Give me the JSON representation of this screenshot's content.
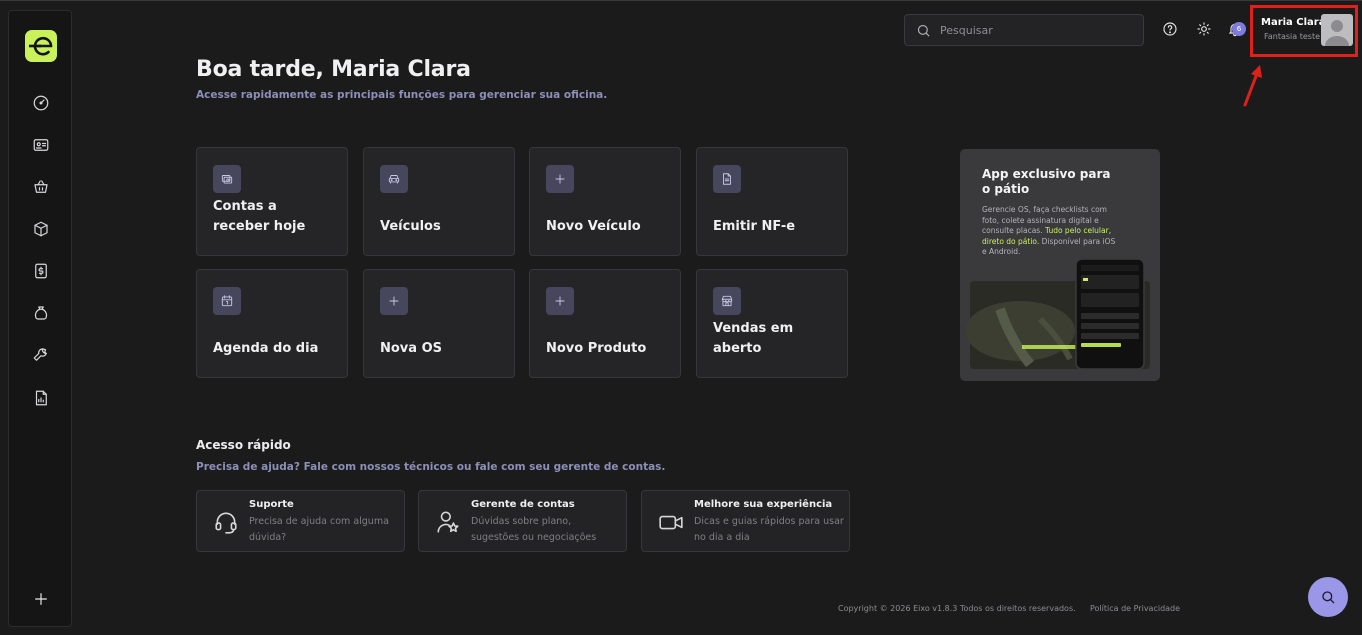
{
  "header": {
    "search_placeholder": "Pesquisar",
    "notification_count": "6",
    "user_name": "Maria Clara",
    "user_company": "Fantasia teste"
  },
  "greeting": {
    "title": "Boa tarde, Maria Clara",
    "subtitle": "Acesse rapidamente as principais funções para gerenciar sua oficina."
  },
  "cards": [
    {
      "label": "Contas a receber hoje",
      "icon": "money-receive-icon"
    },
    {
      "label": "Veículos",
      "icon": "car-icon"
    },
    {
      "label": "Novo Veículo",
      "icon": "plus-icon"
    },
    {
      "label": "Emitir NF-e",
      "icon": "document-icon"
    },
    {
      "label": "Agenda do dia",
      "icon": "calendar-icon"
    },
    {
      "label": "Nova OS",
      "icon": "plus-icon"
    },
    {
      "label": "Novo Produto",
      "icon": "plus-icon"
    },
    {
      "label": "Vendas em aberto",
      "icon": "store-icon"
    }
  ],
  "promo": {
    "title": "App exclusivo para o pátio",
    "text_before": "Gerencie OS, faça checklists com foto, colete assinatura digital e consulte placas. ",
    "text_highlight": "Tudo pelo celular, direto do pátio.",
    "text_after": " Disponível para iOS e Android."
  },
  "quick_access": {
    "title": "Acesso rápido",
    "subtitle": "Precisa de ajuda? Fale com nossos técnicos ou fale com seu gerente de contas.",
    "items": [
      {
        "title": "Suporte",
        "description": "Precisa de ajuda com alguma dúvida?",
        "icon": "headset-icon"
      },
      {
        "title": "Gerente de contas",
        "description": "Dúvidas sobre plano, sugestões ou negociações",
        "icon": "user-star-icon"
      },
      {
        "title": "Melhore sua experiência",
        "description": "Dicas e guias rápidos para usar no dia a dia",
        "icon": "video-icon"
      }
    ]
  },
  "footer": {
    "copyright": "Copyright © 2026 Eixo v1.8.3 Todos os direitos reservados.",
    "privacy": "Política de Privacidade"
  },
  "colors": {
    "accent": "#c9f25a",
    "highlight_box": "#e0211b",
    "subtitle": "#8c8fb8",
    "fab": "#9a97e8"
  }
}
